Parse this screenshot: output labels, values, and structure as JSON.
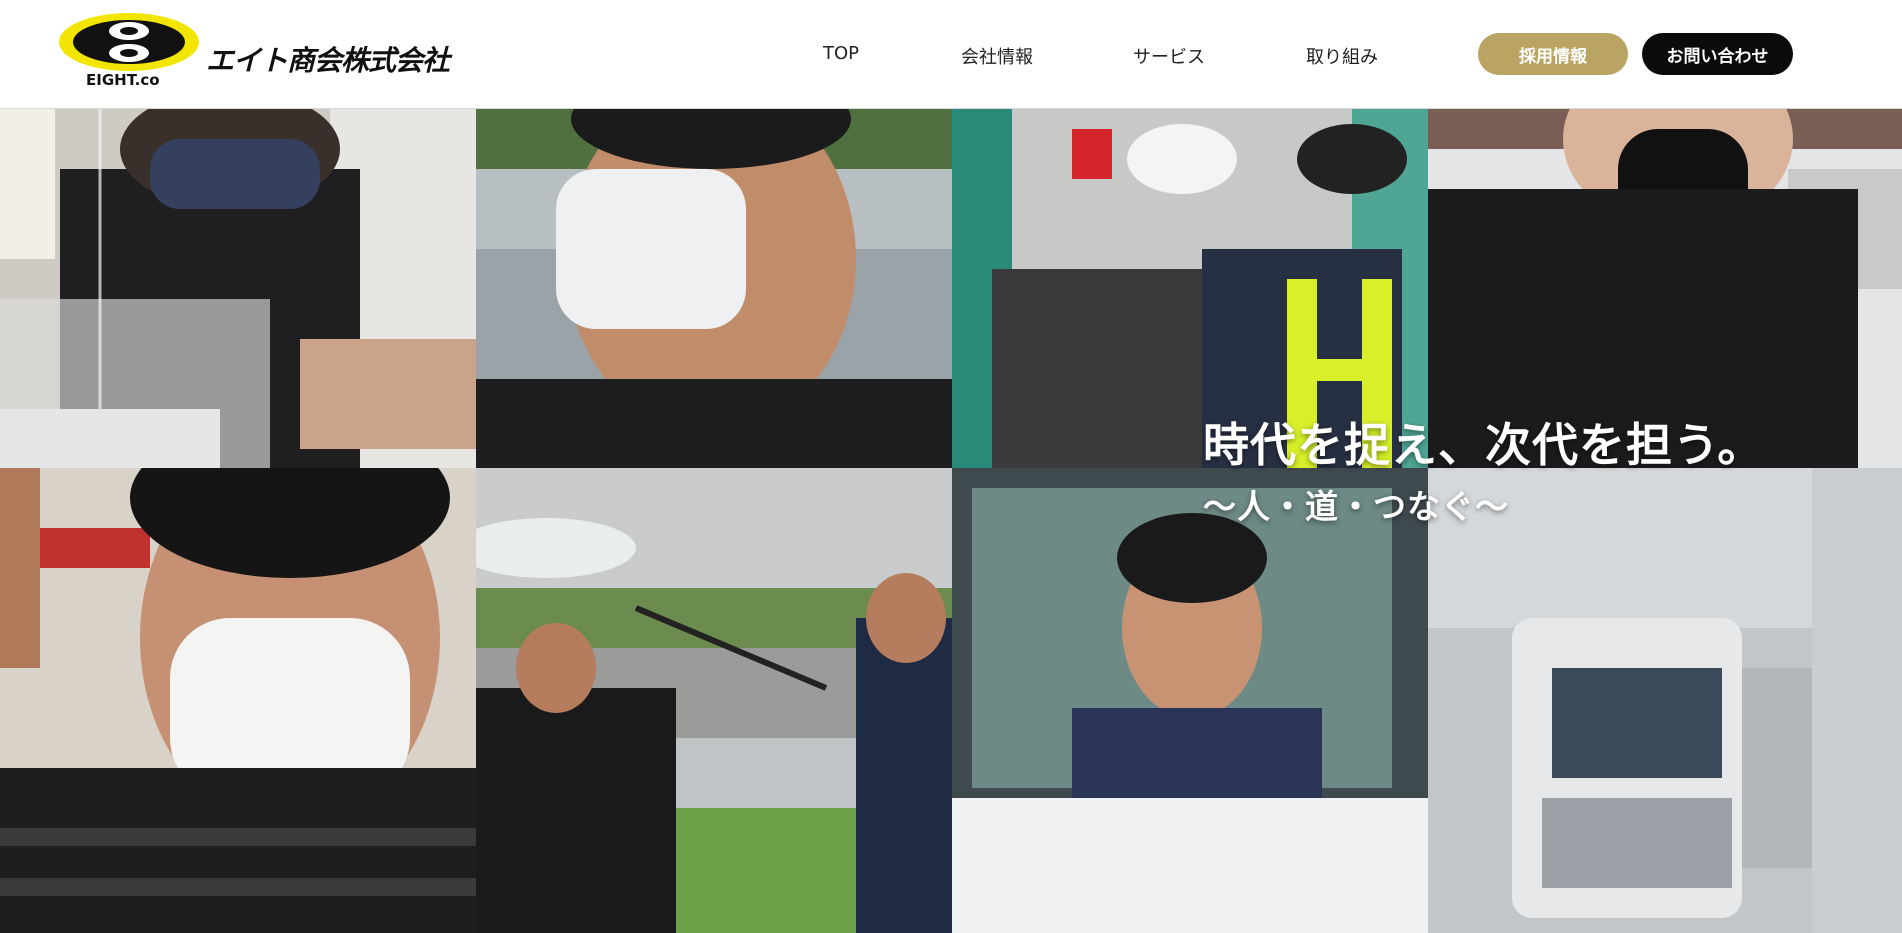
{
  "header": {
    "logo": {
      "mark_text": "EIGHT.co",
      "company_name": "エイト商会株式会社"
    },
    "nav": [
      {
        "label": "TOP"
      },
      {
        "label": "会社情報"
      },
      {
        "label": "サービス"
      },
      {
        "label": "取り組み"
      }
    ],
    "recruit_button": "採用情報",
    "contact_button": "お問い合わせ"
  },
  "hero": {
    "headline": "時代を捉え、次代を担う。",
    "subline": "〜人・道・つなぐ〜",
    "photos": [
      "staff at reception desk with acrylic partition",
      "smiling man wearing white mask",
      "forklift operator with worker in safety vest",
      "woman in black mask and uniform",
      "man in mask waving",
      "workers washing with pressure hose",
      "driver smiling in truck cab and silver truck"
    ]
  },
  "colors": {
    "recruit_button": "#b9a464",
    "contact_button": "#0b0b0b",
    "logo_yellow": "#f2e600",
    "text": "#222222"
  }
}
